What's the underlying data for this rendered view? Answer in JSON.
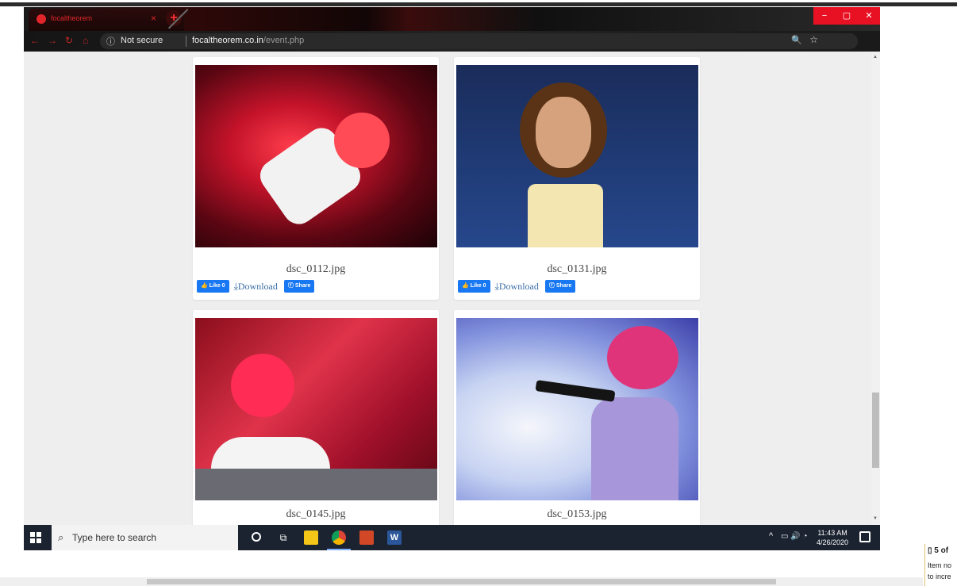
{
  "browser": {
    "tab_title": "focaltheorem",
    "tab_close": "×",
    "new_tab": "+",
    "window_controls": [
      "−",
      "▢",
      "✕"
    ],
    "security_label": "Not secure",
    "url_domain": "focaltheorem.co.in",
    "url_path": "/event.php",
    "accent_color": "#e0262a"
  },
  "gallery": {
    "items": [
      {
        "filename": "dsc_0112.jpg",
        "like_label": "Like 0",
        "download_label": "Download",
        "share_label": "Share"
      },
      {
        "filename": "dsc_0131.jpg",
        "like_label": "Like 0",
        "download_label": "Download",
        "share_label": "Share"
      },
      {
        "filename": "dsc_0145.jpg"
      },
      {
        "filename": "dsc_0153.jpg"
      }
    ]
  },
  "taskbar": {
    "search_placeholder": "Type here to search",
    "time": "11:43 AM",
    "date": "4/26/2020",
    "word_label": "W"
  },
  "sidepanel": {
    "line1": "5 of",
    "line2": "Item no",
    "line3": "to incre"
  }
}
